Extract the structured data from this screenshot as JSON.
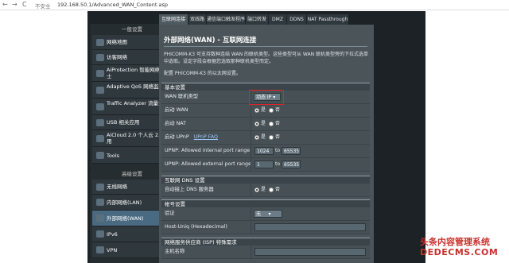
{
  "browser": {
    "back": "←",
    "forward": "→",
    "reload": "C",
    "security": "不安全",
    "url": "192.168.50.1/Advanced_WAN_Content.asp"
  },
  "sidebar": {
    "section1": "一般设置",
    "items": [
      {
        "label": "网络地图"
      },
      {
        "label": "访客网络"
      },
      {
        "label": "AiProtection 智能网络卫士"
      },
      {
        "label": "Adaptive QoS 网络监控家"
      },
      {
        "label": "Traffic Analyzer 流量分析"
      },
      {
        "label": "USB 相关应用"
      },
      {
        "label": "AiCloud 2.0 个人云 2.0 应用"
      },
      {
        "label": "Tools"
      }
    ],
    "section2": "高级设置",
    "advanced": [
      {
        "label": "无线网络"
      },
      {
        "label": "内部网络(LAN)"
      },
      {
        "label": "外部网络(WAN)"
      },
      {
        "label": "IPv6"
      },
      {
        "label": "VPN"
      }
    ]
  },
  "tabs": [
    "互联网连接",
    "双线路",
    "通信端口触发程序",
    "端口转发",
    "DMZ",
    "DDNS",
    "NAT Passthrough"
  ],
  "page": {
    "title": "外部网络(WAN) - 互联网连接",
    "desc1": "PHICOMM-K3 可支持数种连结 WAN 的联机类型。这些类型可从 WAN 联机类型旁的下拉式选单中选取。设定字段会根据您选取那种联机类型而定。",
    "desc2": "配置 PHICOMM-K3 的以太网设置。"
  },
  "basic": {
    "header": "基本设置",
    "wan_type_label": "WAN 联机类型",
    "wan_type_value": "动态 IP",
    "enable_wan_label": "启动 WAN",
    "enable_nat_label": "启动 NAT",
    "upnp_label": "启动 UPnP",
    "upnp_faq": "UPnP FAQ",
    "upnp_internal_label": "UPNP: Allowed internal port range",
    "upnp_internal_from": "1024",
    "upnp_internal_to": "65535",
    "upnp_external_label": "UPNP: Allowed external port range",
    "upnp_external_from": "1",
    "upnp_external_to": "65535",
    "to": "to",
    "yes": "是",
    "no": "否"
  },
  "dns": {
    "header": "互联网 DNS 设置",
    "auto_label": "自动接上 DNS 服务器"
  },
  "account": {
    "header": "帐号设置",
    "auth_label": "验证",
    "auth_value": "无",
    "host_uniq_label": "Host-Uniq (Hexadecimal)"
  },
  "isp": {
    "header": "网络服务供应商 (ISP) 特殊需求",
    "hostname_label": "主机名称"
  },
  "watermark": {
    "line1": "头条内容管理系统",
    "line2": "DEDECMS.COM"
  }
}
